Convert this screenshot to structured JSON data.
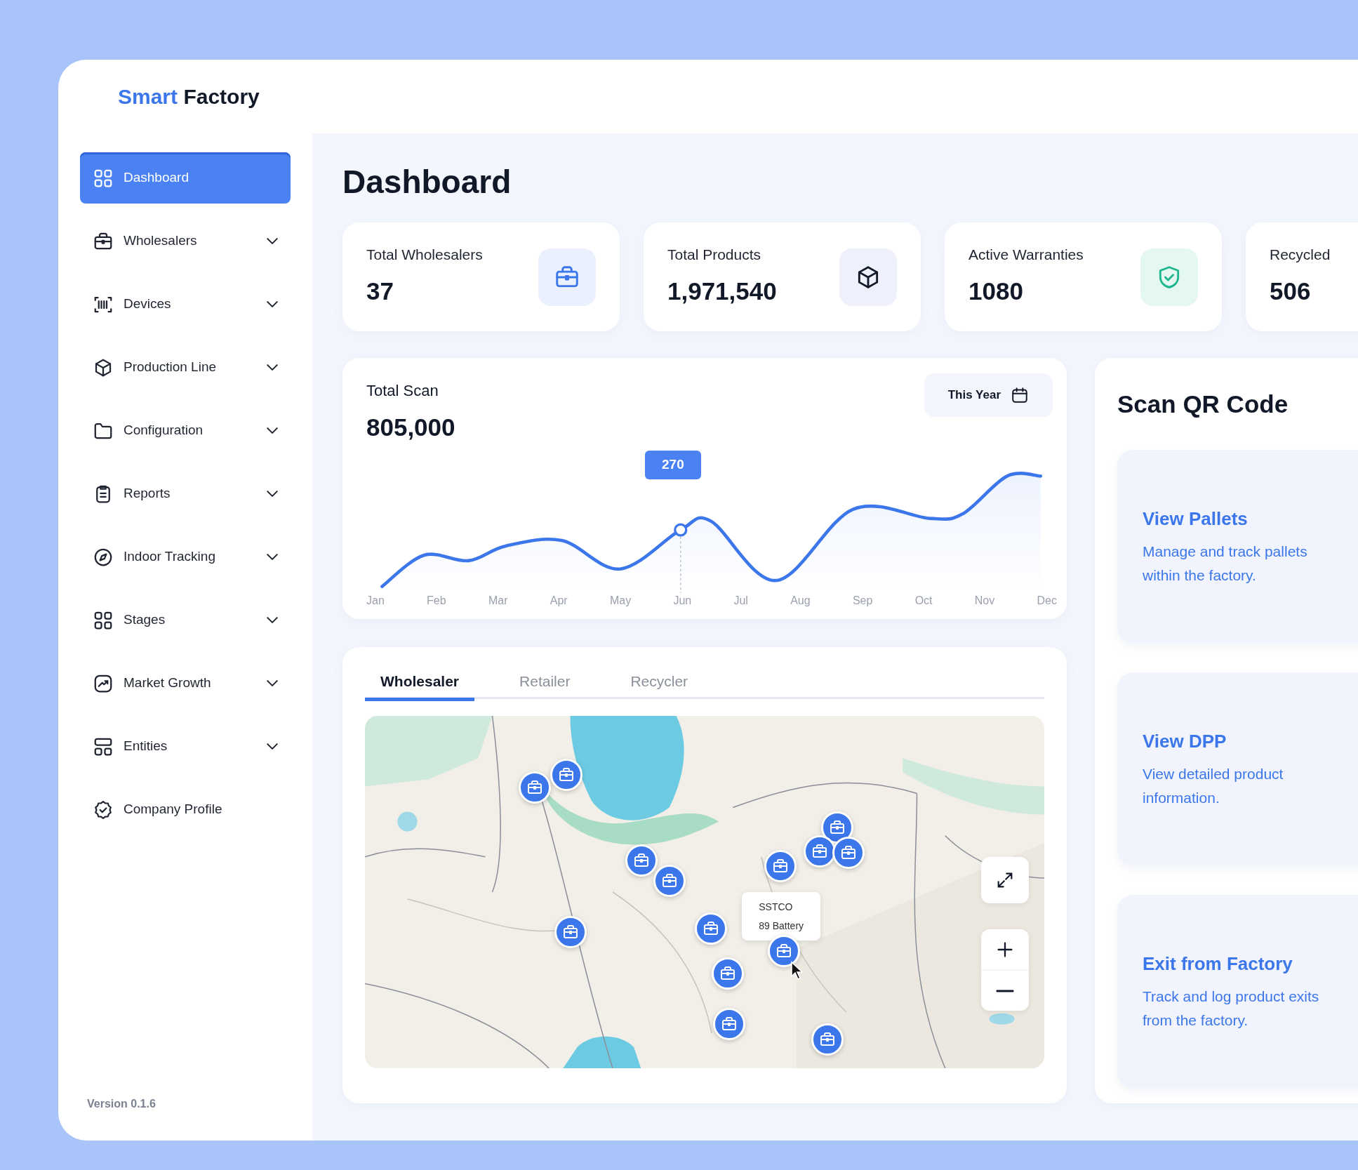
{
  "brand": {
    "first": "Smart",
    "second": "Factory"
  },
  "sidebar": {
    "items": [
      {
        "label": "Dashboard",
        "selected": true,
        "has_submenu": false
      },
      {
        "label": "Wholesalers",
        "selected": false,
        "has_submenu": true
      },
      {
        "label": "Devices",
        "selected": false,
        "has_submenu": true
      },
      {
        "label": "Production Line",
        "selected": false,
        "has_submenu": true
      },
      {
        "label": "Configuration",
        "selected": false,
        "has_submenu": true
      },
      {
        "label": "Reports",
        "selected": false,
        "has_submenu": true
      },
      {
        "label": "Indoor Tracking",
        "selected": false,
        "has_submenu": true
      },
      {
        "label": "Stages",
        "selected": false,
        "has_submenu": true
      },
      {
        "label": "Market Growth",
        "selected": false,
        "has_submenu": true
      },
      {
        "label": "Entities",
        "selected": false,
        "has_submenu": true
      },
      {
        "label": "Company Profile",
        "selected": false,
        "has_submenu": false
      }
    ],
    "version": "Version 0.1.6"
  },
  "page_title": "Dashboard",
  "stats": [
    {
      "label": "Total Wholesalers",
      "value": "37"
    },
    {
      "label": "Total Products",
      "value": "1,971,540"
    },
    {
      "label": "Active Warranties",
      "value": "1080"
    },
    {
      "label": "Recycled",
      "value": "506"
    }
  ],
  "scan_chart": {
    "title": "Total Scan",
    "value": "805,000",
    "period_button": "This Year",
    "tooltip": "270",
    "months": [
      "Jan",
      "Feb",
      "Mar",
      "Apr",
      "May",
      "Jun",
      "Jul",
      "Aug",
      "Sep",
      "Oct",
      "Nov",
      "Dec"
    ]
  },
  "map_panel": {
    "tabs": [
      {
        "label": "Wholesaler",
        "selected": true
      },
      {
        "label": "Retailer",
        "selected": false
      },
      {
        "label": "Recycler",
        "selected": false
      }
    ],
    "popup": {
      "name": "SSTCO",
      "detail": "89 Battery"
    }
  },
  "scan_qr": {
    "title": "Scan QR Code",
    "actions": [
      {
        "title": "View Pallets",
        "description": "Manage and track pallets within the factory."
      },
      {
        "title": "View DPP",
        "description": "View detailed product information."
      },
      {
        "title": "Exit from Factory",
        "description": "Track and log product exits from the factory."
      }
    ]
  }
}
